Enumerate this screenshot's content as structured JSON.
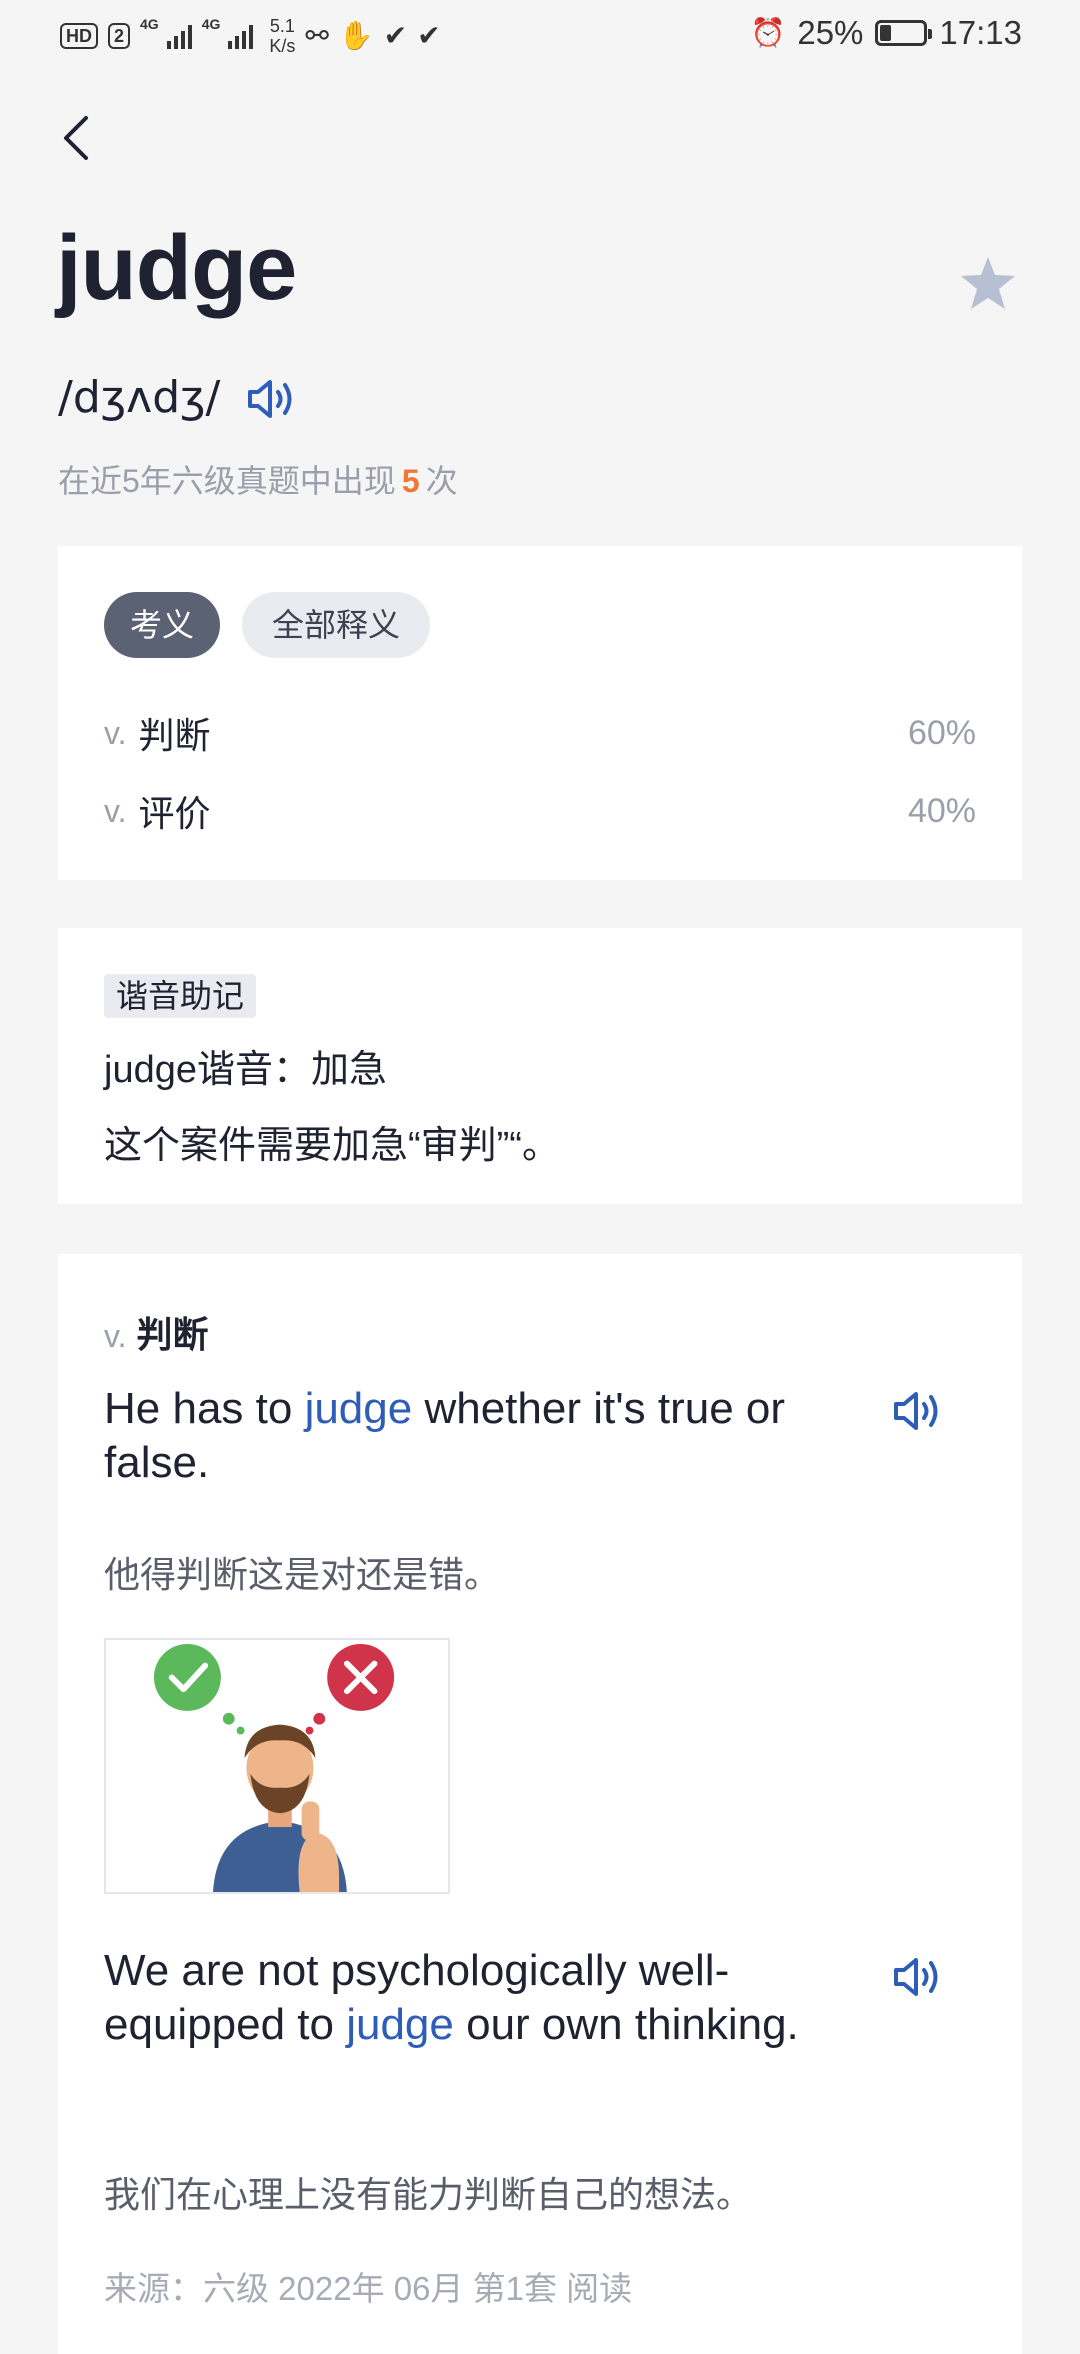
{
  "status_bar": {
    "hd": "HD",
    "sim": "2",
    "net1": "4G",
    "net2": "4G",
    "speed_value": "5.1",
    "speed_unit": "K/s",
    "battery_percent": "25%",
    "battery_level": 0.25,
    "time": "17:13"
  },
  "word": "judge",
  "phonetic": "/dʒʌdʒ/",
  "exam_stat": {
    "prefix": "在近5年六级真题中出现",
    "count": "5",
    "suffix": "次"
  },
  "meaning_tabs": [
    {
      "label": "考义",
      "active": true
    },
    {
      "label": "全部释义",
      "active": false
    }
  ],
  "meanings": [
    {
      "pos": "v.",
      "text": "判断",
      "percent": "60%"
    },
    {
      "pos": "v.",
      "text": "评价",
      "percent": "40%"
    }
  ],
  "mnemonic": {
    "tag": "谐音助记",
    "line1": "judge谐音：加急",
    "line2": "这个案件需要加急“审判”“。"
  },
  "example_section": {
    "pos": "v.",
    "meaning": "判断",
    "examples": [
      {
        "en_before": "He has to ",
        "en_keyword": "judge",
        "en_after": " whether it's true or false.",
        "zh": "他得判断这是对还是错。"
      },
      {
        "en_before": "We are not psychologically well-equipped to ",
        "en_keyword": "judge",
        "en_after": " our own thinking.",
        "zh": "我们在心理上没有能力判断自己的想法。"
      }
    ],
    "source": "来源：六级 2022年 06月 第1套 阅读"
  },
  "colors": {
    "accent_blue": "#2e5db8",
    "count_orange": "#f07835",
    "check_green": "#5bb85b",
    "cross_red": "#d0344a"
  },
  "icons": [
    "back-arrow-icon",
    "star-icon",
    "speaker-icon",
    "check-icon",
    "cross-icon"
  ]
}
